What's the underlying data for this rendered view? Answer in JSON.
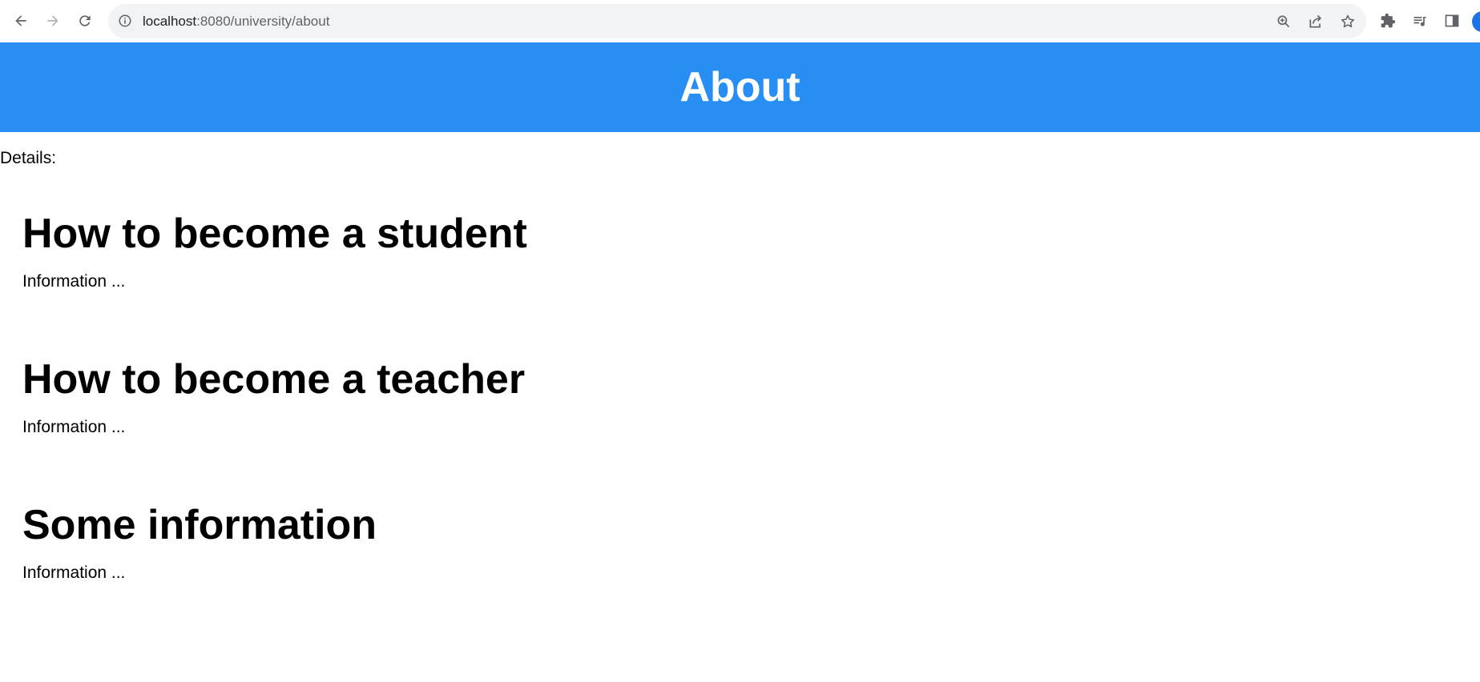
{
  "browser": {
    "url_host": "localhost",
    "url_rest": ":8080/university/about",
    "icons": {
      "back": "arrow-left-icon",
      "forward": "arrow-right-icon",
      "reload": "reload-icon",
      "site_info": "info-icon",
      "zoom": "zoom-icon",
      "share": "share-icon",
      "bookmark": "star-icon",
      "extensions": "puzzle-icon",
      "media": "media-queue-icon",
      "side_panel": "side-panel-icon"
    }
  },
  "page": {
    "header_title": "About",
    "header_color": "#288ef3",
    "details_label": "Details:",
    "sections": [
      {
        "title": "How to become a student",
        "body": "Information ..."
      },
      {
        "title": "How to become a teacher",
        "body": "Information ..."
      },
      {
        "title": "Some information",
        "body": "Information ..."
      }
    ]
  }
}
